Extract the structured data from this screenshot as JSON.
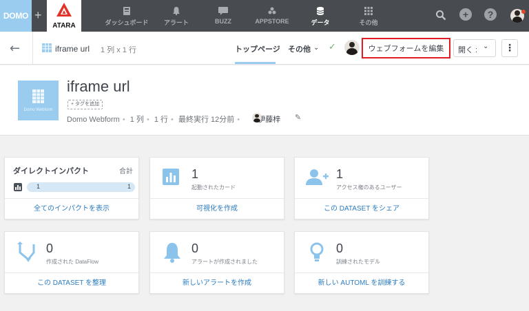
{
  "topnav": {
    "logo": "DOMO",
    "plus": "+",
    "instance_name": "ATARA",
    "items": [
      {
        "label": "ダッシュボード",
        "icon": "dashboard-icon"
      },
      {
        "label": "アラート",
        "icon": "bell-icon"
      },
      {
        "label": "BUZZ",
        "icon": "chat-icon"
      },
      {
        "label": "APPSTORE",
        "icon": "appstore-icon"
      },
      {
        "label": "データ",
        "icon": "database-icon",
        "active": true
      },
      {
        "label": "その他",
        "icon": "grid-icon"
      }
    ]
  },
  "subheader": {
    "dataset_name": "iframe url",
    "dimensions": "1 列 x 1 行",
    "tab_top": "トップページ",
    "tab_other": "その他",
    "edit_button": "ウェブフォームを編集",
    "open_button": "開く :",
    "more": "⋮"
  },
  "detail": {
    "thumbnail_label": "Domo Webform",
    "title": "iframe url",
    "add_tag": "+ タグを追加",
    "connector": "Domo Webform",
    "cols": "1 列",
    "rows": "1 行",
    "last_run_label": "最終実行",
    "last_run_value": "12分前",
    "owner": "伊藤梓"
  },
  "impact": {
    "title": "ダイレクトインパクト",
    "total_label": "合計",
    "bar_left": "1",
    "bar_right": "1",
    "link": "全てのインパクトを表示"
  },
  "cards": [
    {
      "count": "1",
      "desc": "起動されたカード",
      "link": "可視化を作成",
      "icon": "bar-chart-icon"
    },
    {
      "count": "1",
      "desc": "アクセス権のあるユーザー",
      "link": "この DATASET をシェア",
      "icon": "add-user-icon"
    },
    {
      "count": "0",
      "desc": "作成された DataFlow",
      "link": "この DATASET を整理",
      "icon": "dataflow-icon"
    },
    {
      "count": "0",
      "desc": "アラートが作成されました",
      "link": "新しいアラートを作成",
      "icon": "bell-icon"
    },
    {
      "count": "0",
      "desc": "訓練されたモデル",
      "link": "新しい AUTOML を訓練する",
      "icon": "lightbulb-icon"
    }
  ],
  "colors": {
    "nav_bg": "#484c51",
    "brand_blue": "#99ccee",
    "link_blue": "#2b7cc0",
    "highlight_red": "#e01b22",
    "success_green": "#68b36b"
  }
}
